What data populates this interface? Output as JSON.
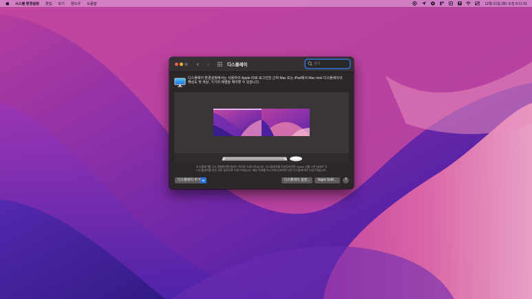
{
  "menubar": {
    "app_name": "시스템 환경설정",
    "items": [
      "편집",
      "보기",
      "윈도우",
      "도움말"
    ],
    "clock": "12월 21일 (화) 오전 8:11:31"
  },
  "window": {
    "title": "디스플레이",
    "search_placeholder": "검색",
    "description_line1": "디스플레이 환경설정에서는 사용자의 Apple ID로 로그인한 근처 Mac 또는 iPad에서 Mac mini 디스플레이의",
    "description_line2": "해상도 및 색상, 기기의 배열을 제어할 수 있습니다.",
    "help_line1": "디스플레이를 다시 정렬하려면 원하는 위치로 드래그하십시오. 디스플레이를 미러링하려면 Option 키를 누른 상태로 각",
    "help_line2": "디스플레이를 원로 서로 겹치도록 드래그하십시오. 메뉴 막대를 다시 위치시키려면 다른 디스플레이로 드래그하십시오.",
    "buttons": {
      "add_display": "디스플레이 추가",
      "display_settings": "디스플레이 설정...",
      "night_shift": "Night Shift...",
      "help": "?"
    }
  },
  "colors": {
    "accent": "#2f70cf",
    "close": "#ee5e56",
    "minimize": "#f0b32f"
  }
}
